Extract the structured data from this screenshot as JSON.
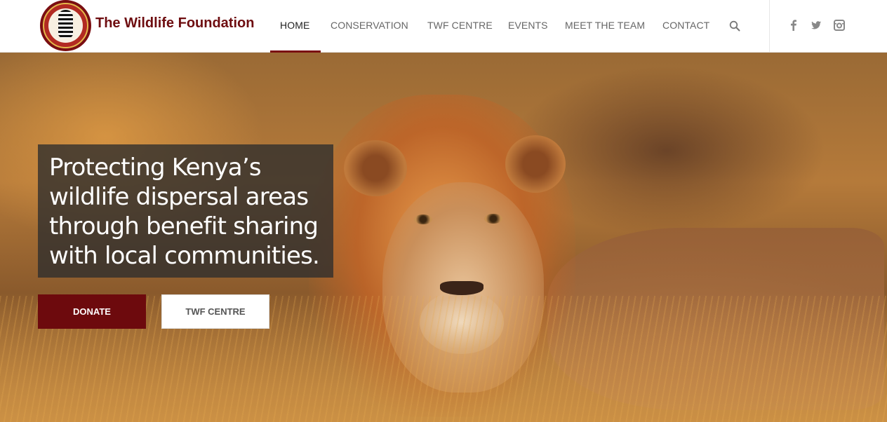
{
  "header": {
    "logo_text": "THE WILDLIFE FOUNDATION",
    "brand": "The Wildlife Foundation",
    "nav": [
      {
        "label": "HOME",
        "active": true
      },
      {
        "label": "CONSERVATION",
        "active": false
      },
      {
        "label": "TWF CENTRE",
        "active": false
      },
      {
        "label": "EVENTS",
        "active": false
      },
      {
        "label": "MEET THE TEAM",
        "active": false
      },
      {
        "label": "CONTACT",
        "active": false
      }
    ],
    "icons": [
      "search-icon",
      "facebook-icon",
      "twitter-icon",
      "instagram-icon"
    ]
  },
  "hero": {
    "headline": "Protecting Kenya’s wildlife dispersal areas through benefit sharing with local communities.",
    "buttons": {
      "donate": "DONATE",
      "centre": "TWF CENTRE"
    }
  },
  "colors": {
    "brand": "#6e0d10",
    "accent": "#7a0e12",
    "nav_text": "#666666",
    "nav_active": "#222222"
  }
}
